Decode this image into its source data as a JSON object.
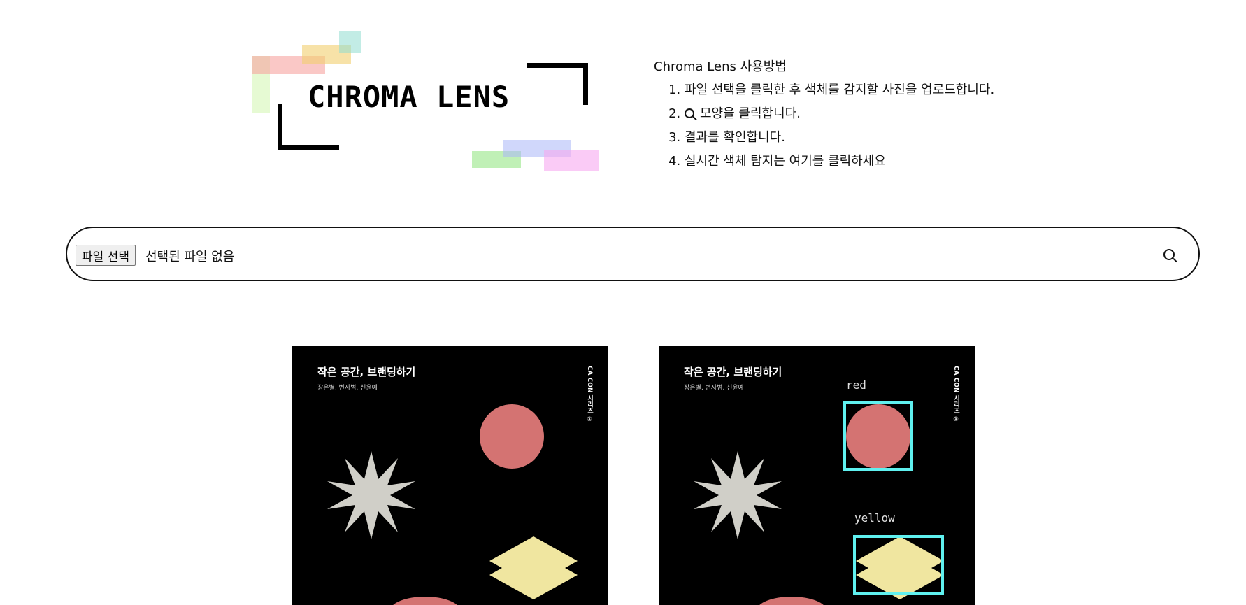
{
  "logo": {
    "text": "CHROMA LENS"
  },
  "howto": {
    "title": "Chroma Lens 사용방법",
    "steps": [
      "파일 선택을 클릭한 후 색체를 감지할 사진을 업로드합니다.",
      "모양을 클릭합니다.",
      "결과를 확인합니다.",
      "실시간 색체 탐지는 "
    ],
    "step4_link": "여기",
    "step4_suffix": "를 클릭하세요"
  },
  "upload": {
    "button_label": "파일 선택",
    "status_text": "선택된 파일 없음",
    "search_icon": "search-icon"
  },
  "images": {
    "original": {
      "title": "작은 공간, 브랜딩하기",
      "authors": "장은별, 변사범, 신윤예",
      "series": "CA CON 시리즈 ①"
    },
    "result": {
      "title": "작은 공간, 브랜딩하기",
      "authors": "장은별, 변사범, 신윤예",
      "series": "CA CON 시리즈 ①",
      "detections": [
        {
          "label": "red"
        },
        {
          "label": "yellow"
        }
      ]
    }
  },
  "colors": {
    "accent_detection": "#5ff0ef",
    "shape_red": "#d47372",
    "shape_yellow": "#f0e6a0",
    "shape_gray": "#d0cfc8"
  }
}
